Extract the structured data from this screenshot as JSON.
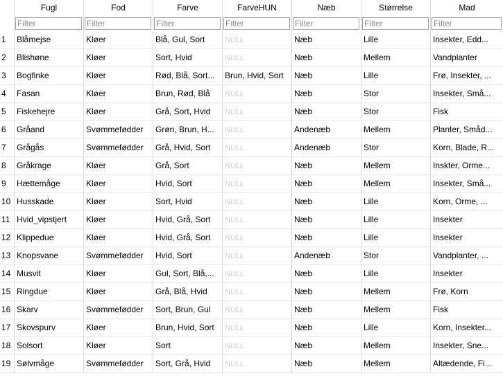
{
  "table": {
    "columns": [
      "Fugl",
      "Fod",
      "Farve",
      "FarveHUN",
      "Næb",
      "Størrelse",
      "Mad"
    ],
    "filter_placeholder": "Filter",
    "null_text": "NULL",
    "rows": [
      {
        "n": "1",
        "cells": [
          "Blåmejse",
          "Kløer",
          "Blå, Gul, Sort",
          null,
          "Næb",
          "Lille",
          "Insekter, Edd..."
        ]
      },
      {
        "n": "2",
        "cells": [
          "Blishøne",
          "Kløer",
          "Sort, Hvid",
          null,
          "Næb",
          "Mellem",
          "Vandplanter"
        ]
      },
      {
        "n": "3",
        "cells": [
          "Bogfinke",
          "Kløer",
          "Rød, Blå, Sort...",
          "Brun, Hvid, Sort",
          "Næb",
          "Lille",
          "Frø, Insekter, ..."
        ]
      },
      {
        "n": "4",
        "cells": [
          "Fasan",
          "Kløer",
          "Brun, Rød, Blå",
          null,
          "Næb",
          "Stor",
          "Insekter, Små..."
        ]
      },
      {
        "n": "5",
        "cells": [
          "Fiskehejre",
          "Kløer",
          "Grå, Sort, Hvid",
          null,
          "Næb",
          "Stor",
          "Fisk"
        ]
      },
      {
        "n": "6",
        "cells": [
          "Gråand",
          "Svømmefødder",
          "Grøn, Brun, H...",
          null,
          "Andenæb",
          "Mellem",
          "Planter, Småd..."
        ]
      },
      {
        "n": "7",
        "cells": [
          "Grågås",
          "Svømmefødder",
          "Grå, Hvid, Sort",
          null,
          "Andenæb",
          "Stor",
          "Korn, Blade, R..."
        ]
      },
      {
        "n": "8",
        "cells": [
          "Gråkrage",
          "Kløer",
          "Grå, Sort",
          null,
          "Næb",
          "Mellem",
          "Inskter, Orme..."
        ]
      },
      {
        "n": "9",
        "cells": [
          "Hættemåge",
          "Kløer",
          "Hvid, Sort",
          null,
          "Næb",
          "Mellem",
          "Insekter, Små..."
        ]
      },
      {
        "n": "10",
        "cells": [
          "Husskade",
          "Kløer",
          "Sort, Hvid",
          null,
          "Næb",
          "Lille",
          "Korn, Orme, ..."
        ]
      },
      {
        "n": "11",
        "cells": [
          "Hvid_vipstjert",
          "Kløer",
          "Hvid, Grå, Sort",
          null,
          "Næb",
          "Lille",
          "Insekter"
        ]
      },
      {
        "n": "12",
        "cells": [
          "Klippedue",
          "Kløer",
          "Hvid, Grå, Sort",
          null,
          "Næb",
          "Lille",
          "Insekter"
        ]
      },
      {
        "n": "13",
        "cells": [
          "Knopsvane",
          "Svømmefødder",
          "Hvid, Sort",
          null,
          "Andenæb",
          "Stor",
          "Vandplanter, ..."
        ]
      },
      {
        "n": "14",
        "cells": [
          "Musvit",
          "Kløer",
          "Gul, Sort, Blå,...",
          null,
          "Næb",
          "Lille",
          "Insekter"
        ]
      },
      {
        "n": "15",
        "cells": [
          "Ringdue",
          "Kløer",
          "Grå, Blå, Hvid",
          null,
          "Næb",
          "Mellem",
          "Frø, Korn"
        ]
      },
      {
        "n": "16",
        "cells": [
          "Skarv",
          "Svømmefødder",
          "Sort, Brun, Gul",
          null,
          "Næb",
          "Mellem",
          "Fisk"
        ]
      },
      {
        "n": "17",
        "cells": [
          "Skovspurv",
          "Kløer",
          "Brun, Hvid, Sort",
          null,
          "Næb",
          "Lille",
          "Korn, Insekter..."
        ]
      },
      {
        "n": "18",
        "cells": [
          "Solsort",
          "Kløer",
          "Sort",
          null,
          "Næb",
          "Mellem",
          "Insekter, Sne..."
        ]
      },
      {
        "n": "19",
        "cells": [
          "Sølvmåge",
          "Svømmefødder",
          "Sort, Grå, Hvid",
          null,
          "Næb",
          "Mellem",
          "Altædende, Fi..."
        ]
      }
    ]
  }
}
